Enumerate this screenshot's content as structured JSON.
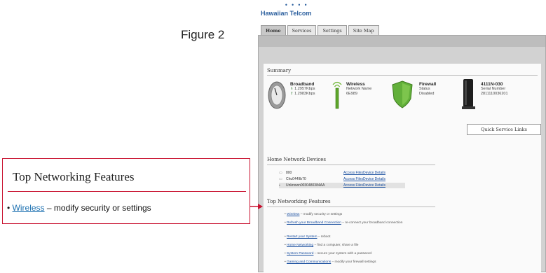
{
  "brand": {
    "name": "Hawaiian Telcom",
    "dots": "• • • •"
  },
  "figure_label": "Figure 2",
  "tabs": [
    "Home",
    "Services",
    "Settings",
    "Site Map"
  ],
  "summary": {
    "title": "Summary",
    "broadband": {
      "label": "Broadband",
      "down": "1.2957Kbps",
      "up": "1.2983Kbps"
    },
    "wireless": {
      "label": "Wireless",
      "field": "Network Name",
      "value": "6E989"
    },
    "firewall": {
      "label": "Firewall",
      "field": "Status",
      "value": "Disabled"
    },
    "device": {
      "label": "4111N-030",
      "field": "Serial Number",
      "value": "2811110036201"
    }
  },
  "quick_links": "Quick Service Links",
  "home_devices": {
    "title": "Home Network Devices",
    "rows": [
      {
        "name": "800",
        "a": "Access Files",
        "b": "Device Details"
      },
      {
        "name": "Chu0449b70",
        "a": "Access Files",
        "b": "Device Details"
      },
      {
        "name": "Unknown0030480384AA",
        "a": "Access Files",
        "b": "Device Details"
      }
    ]
  },
  "features": {
    "title": "Top Networking Features",
    "items": [
      {
        "link": "Wireless",
        "desc": " – modify security or settings"
      },
      {
        "link": "Refresh your Broadband Connection",
        "desc": " – re-connect your broadband connection"
      },
      {
        "link": "Restart your System",
        "desc": " – reboot"
      },
      {
        "link": "Home Networking",
        "desc": " – find a computer, share a file"
      },
      {
        "link": "System Password",
        "desc": " – secure your system with a password"
      },
      {
        "link": "Gaming and Communications",
        "desc": " – modify your firewall settings"
      }
    ]
  },
  "callout": {
    "title": "Top Networking Features",
    "bullet": "•",
    "link": "Wireless",
    "desc": " – modify security or settings"
  },
  "colors": {
    "accent": "#c8102e",
    "link": "#1a6fb0",
    "brand": "#2b5f9e"
  }
}
